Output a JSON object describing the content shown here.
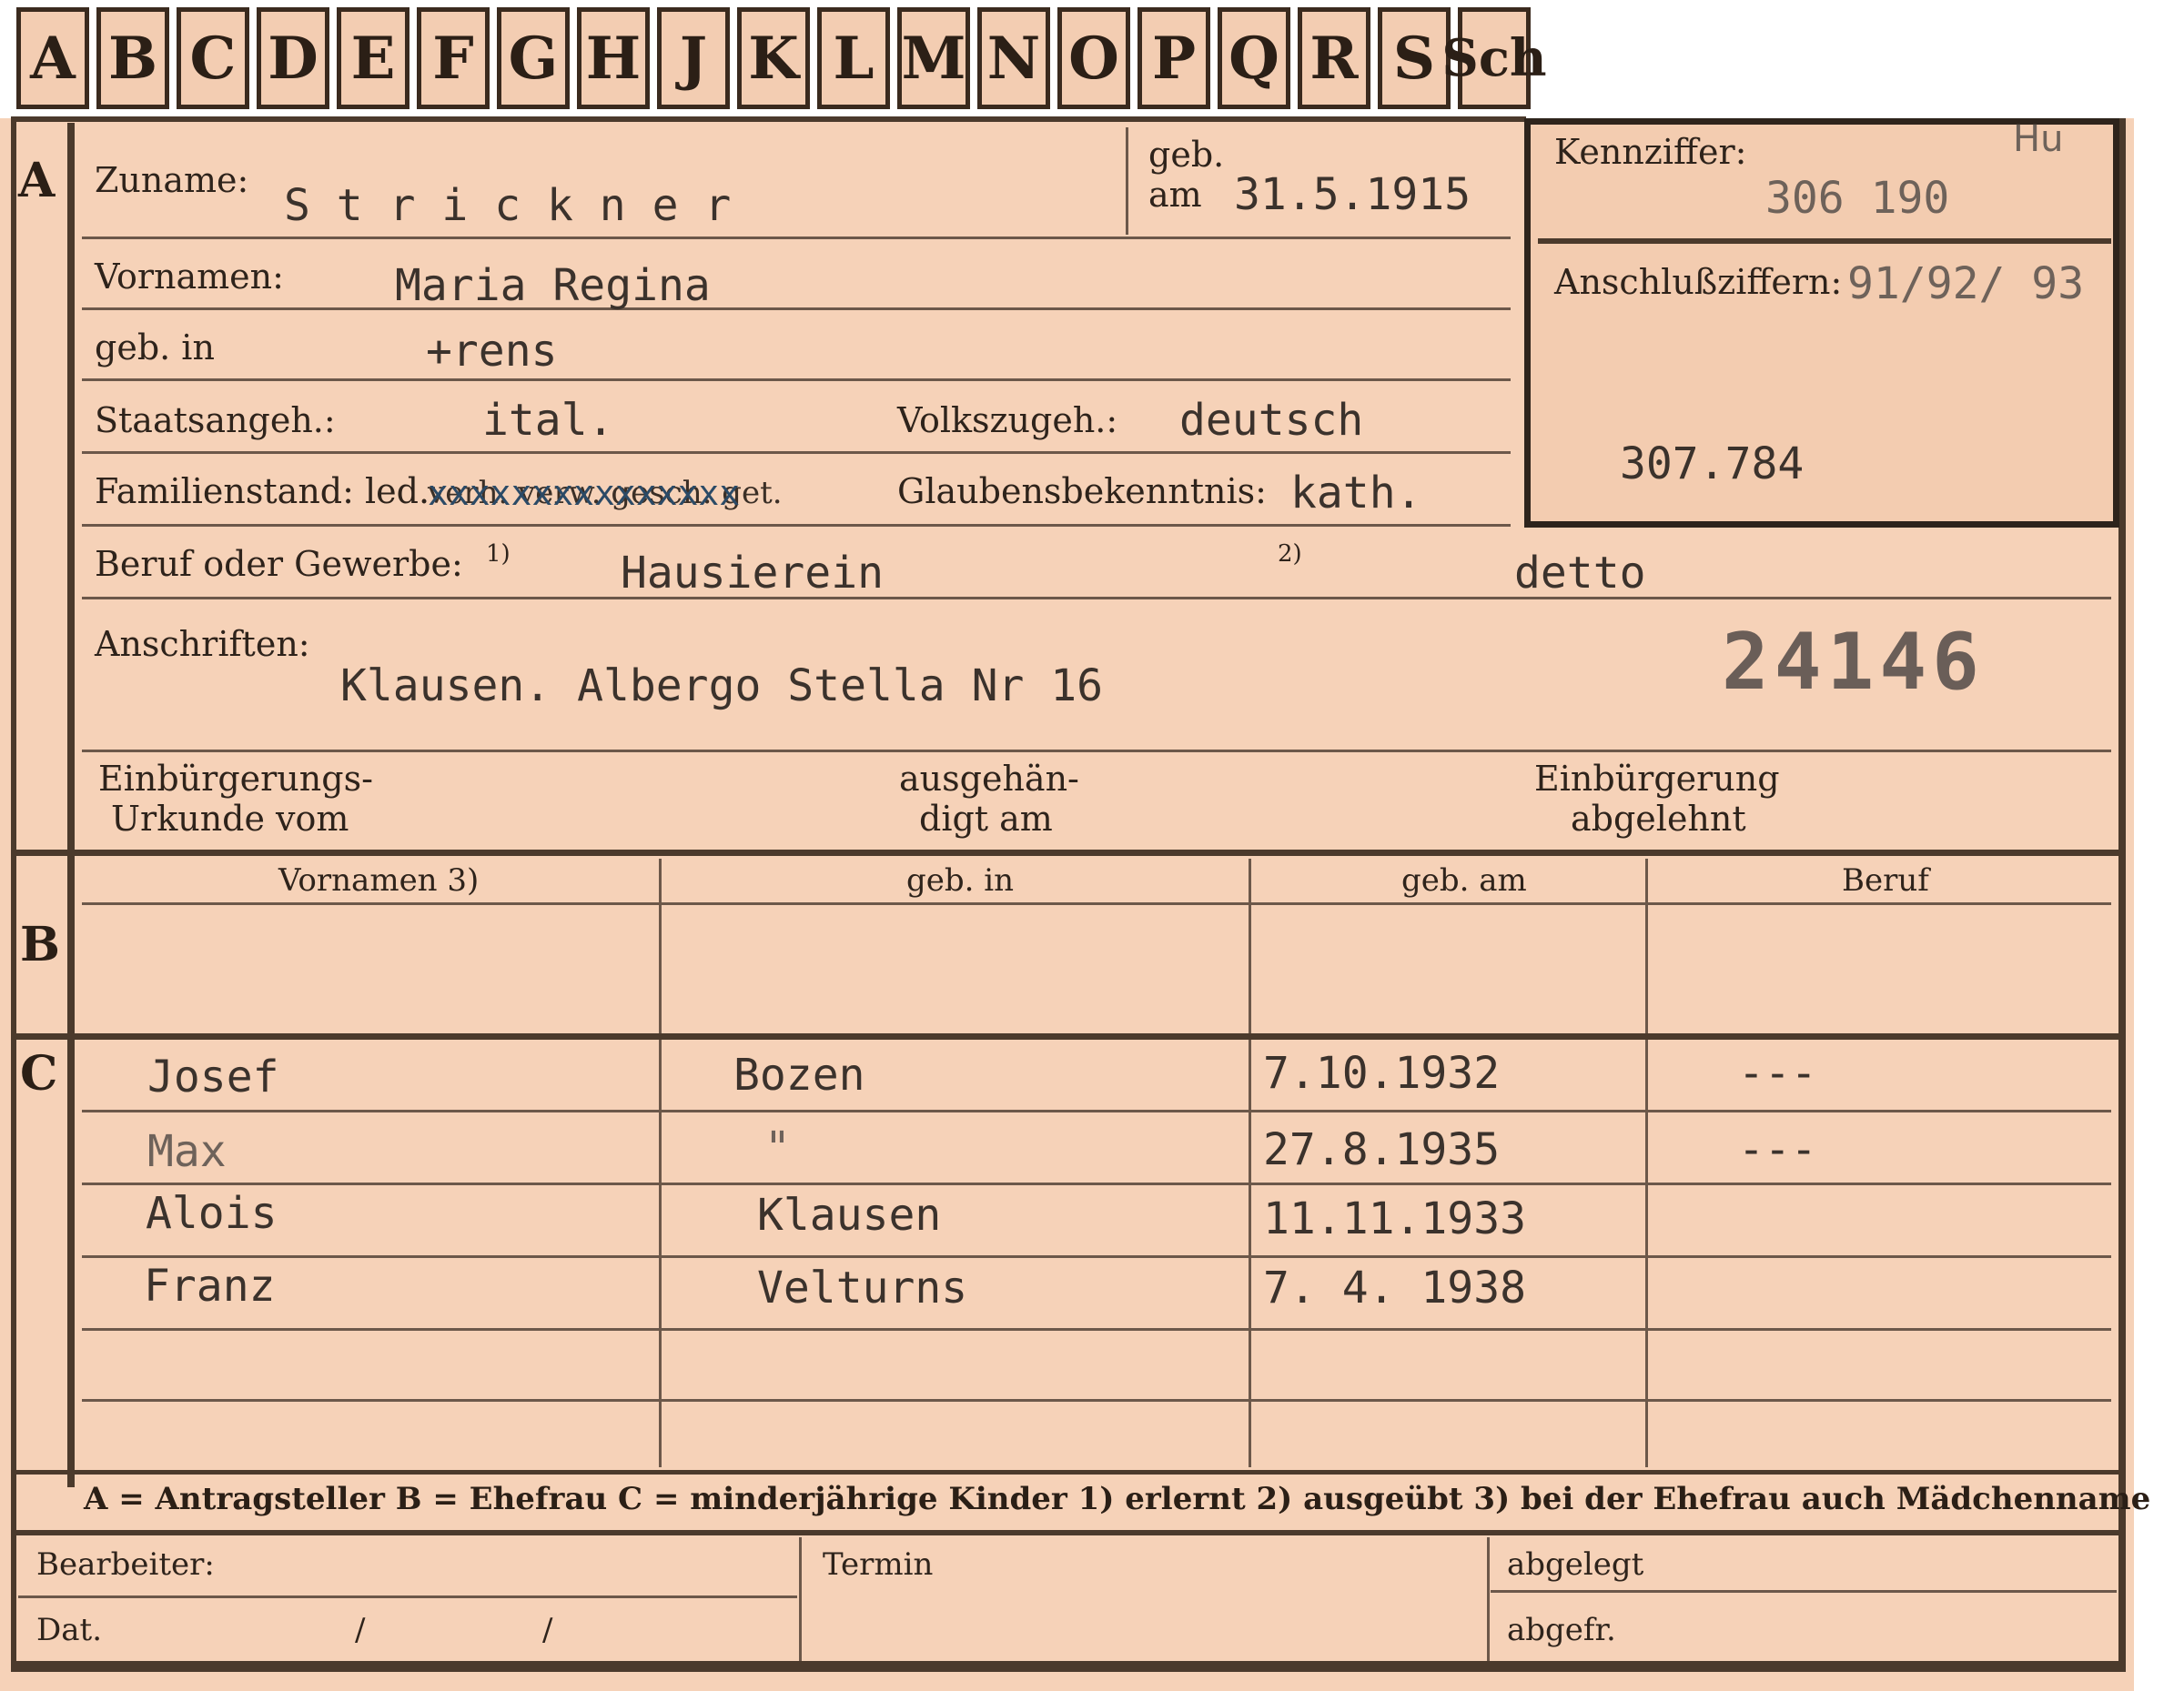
{
  "tabs": [
    "A",
    "B",
    "C",
    "D",
    "E",
    "F",
    "G",
    "H",
    "J",
    "K",
    "L",
    "M",
    "N",
    "O",
    "P",
    "Q",
    "R",
    "S",
    "Sch"
  ],
  "sections": {
    "a": "A",
    "b": "B",
    "c": "C"
  },
  "section_a": {
    "zuname_label": "Zuname:",
    "zuname_value": "S t r i c k n e r",
    "geb_label": "geb.",
    "am_label": "am",
    "birth_date": "31.5.1915",
    "vornamen_label": "Vornamen:",
    "vornamen_value": "Maria Regina",
    "geb_in_label": "geb. in",
    "geb_in_value": "+rens",
    "staatsangeh_label": "Staatsangeh.:",
    "staatsangeh_value": "ital.",
    "volkszugeh_label": "Volkszugeh.:",
    "volkszugeh_value": "deutsch",
    "familienstand_label": "Familienstand: led.",
    "familienstand_struck": "verh. verw. gesch. get.",
    "familienstand_xmarks": "xxxxxxxxxxxxxxx",
    "glaubens_label": "Glaubensbekenntnis:",
    "glaubens_value": "kath.",
    "beruf_label": "Beruf oder Gewerbe:",
    "beruf_note1": "1)",
    "beruf_value1": "Hausierein",
    "beruf_note2": "2)",
    "beruf_value2": "detto",
    "anschriften_label": "Anschriften:",
    "anschriften_value": "Klausen. Albergo Stella Nr 16",
    "stamp_number": "24146",
    "einb_urkunde_line1": "Einbürgerungs-",
    "einb_urkunde_line2": "Urkunde vom",
    "ausgeh_line1": "ausgehän-",
    "ausgeh_line2": "digt am",
    "einb_abgelehnt_line1": "Einbürgerung",
    "einb_abgelehnt_line2": "abgelehnt"
  },
  "right_box": {
    "kennziffer_label": "Kennziffer:",
    "kennziffer_value": "306 190",
    "initials": "Hu",
    "anschluss_label": "Anschlußziffern:",
    "anschluss_value": "91/92/ 93",
    "extra_number": "307.784"
  },
  "table_headers": [
    "Vornamen 3)",
    "geb. in",
    "geb. am",
    "Beruf"
  ],
  "children": [
    {
      "vorname": "Josef",
      "geb_in": "Bozen",
      "geb_am": "7.10.1932",
      "beruf": "---"
    },
    {
      "vorname": "Max",
      "geb_in": "\"",
      "geb_am": "27.8.1935",
      "beruf": "---"
    },
    {
      "vorname": "Alois",
      "geb_in": "Klausen",
      "geb_am": "11.11.1933",
      "beruf": ""
    },
    {
      "vorname": "Franz",
      "geb_in": "Velturns",
      "geb_am": "7. 4. 1938",
      "beruf": ""
    }
  ],
  "legend": "A = Antragsteller   B = Ehefrau   C = minderjährige Kinder   1) erlernt   2) ausgeübt   3) bei der Ehefrau auch Mädchenname",
  "footer": {
    "bearbeiter_label": "Bearbeiter:",
    "dat_label": "Dat.",
    "dat_slash1": "/",
    "dat_slash2": "/",
    "termin_label": "Termin",
    "abgelegt_label": "abgelegt",
    "abgefr_label": "abgefr."
  },
  "colors": {
    "card": "#f6d2b8",
    "ink": "#2f241c",
    "typewriter": "#3b322c",
    "stamp": "#6a5e58"
  }
}
